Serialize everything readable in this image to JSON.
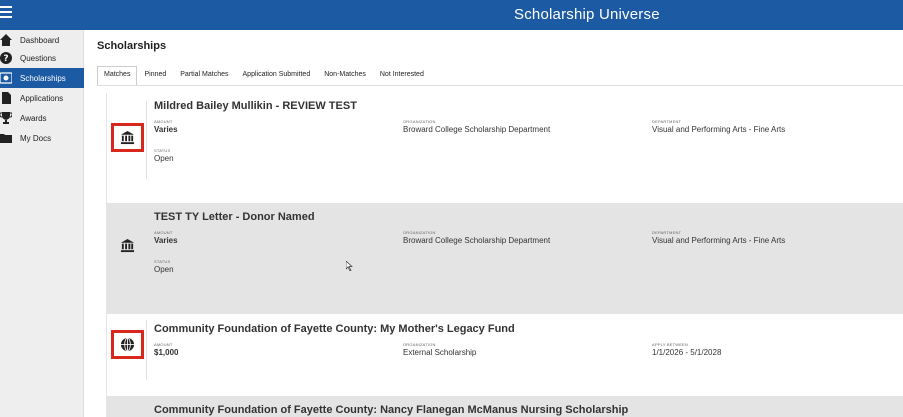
{
  "app": {
    "title": "Scholarship Universe"
  },
  "sidebar": {
    "items": [
      {
        "label": "Dashboard",
        "icon": "home-icon",
        "active": false
      },
      {
        "label": "Questions",
        "icon": "question-icon",
        "active": false
      },
      {
        "label": "Scholarships",
        "icon": "eye-icon",
        "active": true
      },
      {
        "label": "Applications",
        "icon": "document-icon",
        "active": false
      },
      {
        "label": "Awards",
        "icon": "trophy-icon",
        "active": false
      },
      {
        "label": "My Docs",
        "icon": "folder-icon",
        "active": false
      }
    ]
  },
  "main": {
    "title": "Scholarships",
    "tabs": [
      "Matches",
      "Pinned",
      "Partial Matches",
      "Application Submitted",
      "Non-Matches",
      "Not Interested"
    ],
    "active_tab": "Matches"
  },
  "labels": {
    "amount": "AMOUNT",
    "organization": "ORGANIZATION",
    "department": "DEPARTMENT",
    "status": "STATUS",
    "apply_between": "APPLY BETWEEN"
  },
  "scholarships": [
    {
      "title": "Mildred Bailey Mullikin - REVIEW TEST",
      "amount": "Varies",
      "organization": "Broward College Scholarship Department",
      "department": "Visual and Performing Arts - Fine Arts",
      "status": "Open",
      "icon": "institution-icon"
    },
    {
      "title": "TEST TY Letter - Donor Named",
      "amount": "Varies",
      "organization": "Broward College Scholarship Department",
      "department": "Visual and Performing Arts - Fine Arts",
      "status": "Open",
      "icon": "institution-icon"
    },
    {
      "title": "Community Foundation of Fayette County: My Mother's Legacy Fund",
      "amount": "$1,000",
      "organization": "External Scholarship",
      "apply_between": "1/1/2026 - 5/1/2028",
      "icon": "globe-icon"
    },
    {
      "title": "Community Foundation of Fayette County: Nancy Flanegan McManus Nursing Scholarship"
    }
  ],
  "colors": {
    "brand": "#1c5aa3",
    "highlight": "#d8281e",
    "shaded_row": "#e4e4e4"
  }
}
